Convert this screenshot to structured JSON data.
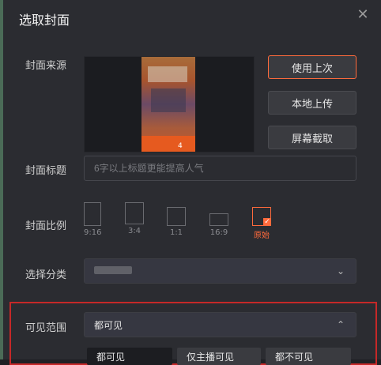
{
  "dialog": {
    "title": "选取封面"
  },
  "source": {
    "label": "封面来源",
    "buttons": {
      "use_last": "使用上次",
      "local_upload": "本地上传",
      "screen_capture": "屏幕截取"
    }
  },
  "title_field": {
    "label": "封面标题",
    "placeholder": "6字以上标题更能提高人气"
  },
  "ratio": {
    "label": "封面比例",
    "options": [
      {
        "label": "9:16"
      },
      {
        "label": "3:4"
      },
      {
        "label": "1:1"
      },
      {
        "label": "16:9"
      },
      {
        "label": "原始"
      }
    ],
    "selected": "原始"
  },
  "category": {
    "label": "选择分类"
  },
  "visibility": {
    "label": "可见范围",
    "value": "都可见",
    "options": [
      {
        "label": "都可见"
      },
      {
        "label": "仅主播可见"
      },
      {
        "label": "都不可见"
      }
    ]
  },
  "colors": {
    "accent": "#ff6a3c",
    "highlight": "#c62828",
    "background": "#2b2c31"
  }
}
